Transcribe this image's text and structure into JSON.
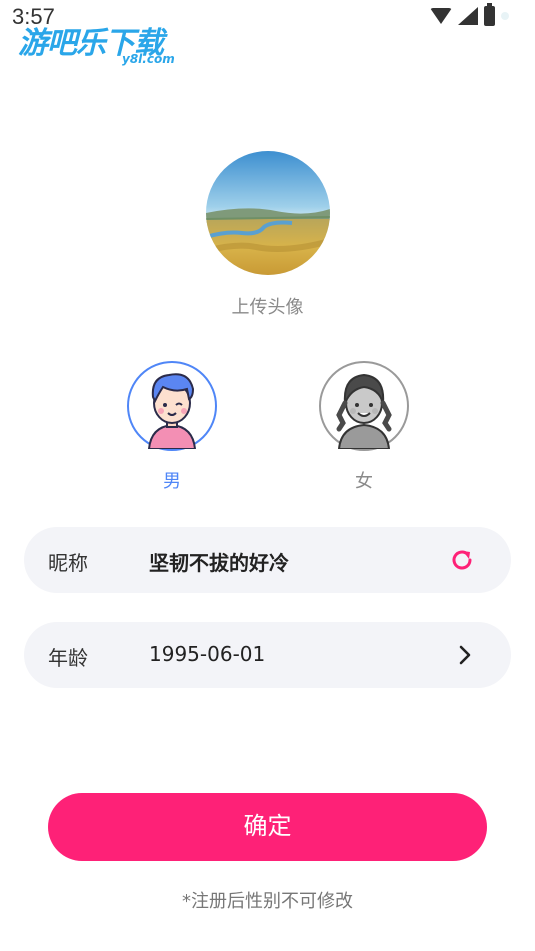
{
  "status_bar": {
    "time": "3:57",
    "icons": [
      "wifi-icon",
      "signal-icon",
      "battery-icon"
    ]
  },
  "watermark": {
    "title": "游吧乐下载",
    "subtitle": "y8l.com"
  },
  "avatar": {
    "label": "上传头像"
  },
  "gender": {
    "selected": "male",
    "options": [
      {
        "id": "male",
        "label": "男",
        "color": "#4f86f7"
      },
      {
        "id": "female",
        "label": "女",
        "color": "#9a9a9a"
      }
    ]
  },
  "form": {
    "nickname": {
      "label": "昵称",
      "value": "坚韧不拔的好冷",
      "action_icon": "refresh-icon"
    },
    "age": {
      "label": "年龄",
      "value": "1995-06-01",
      "action_icon": "chevron-right-icon"
    }
  },
  "confirm_button": {
    "label": "确定",
    "color": "#fe2177"
  },
  "hint": "*注册后性别不可修改"
}
